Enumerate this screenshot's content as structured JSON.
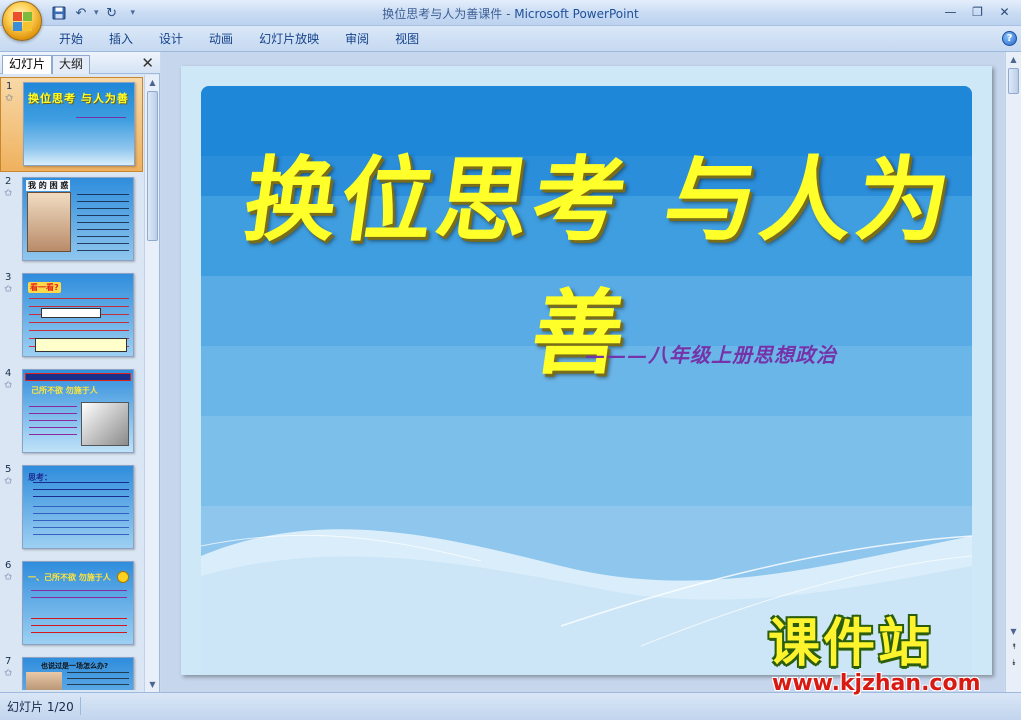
{
  "window": {
    "title": "换位思考与人为善课件",
    "app_name": "Microsoft PowerPoint",
    "title_separator": " - "
  },
  "quick_access": {
    "save_icon": "save-icon",
    "undo_icon": "undo-icon",
    "redo_icon": "redo-icon"
  },
  "ribbon": {
    "tabs": [
      {
        "label": "开始"
      },
      {
        "label": "插入"
      },
      {
        "label": "设计"
      },
      {
        "label": "动画"
      },
      {
        "label": "幻灯片放映"
      },
      {
        "label": "审阅"
      },
      {
        "label": "视图"
      }
    ],
    "help_label": "?"
  },
  "left_pane": {
    "tab_slides": "幻灯片",
    "tab_outline": "大纲",
    "close_label": "✕",
    "thumbnails": [
      {
        "number": "1",
        "selected": true
      },
      {
        "number": "2",
        "selected": false
      },
      {
        "number": "3",
        "selected": false
      },
      {
        "number": "4",
        "selected": false
      },
      {
        "number": "5",
        "selected": false
      },
      {
        "number": "6",
        "selected": false
      },
      {
        "number": "7",
        "selected": false
      }
    ],
    "thumb_text": {
      "s1_title": "换位思考  与人为善",
      "s2_title": "我 的 困 惑",
      "s3_title": "看一看?",
      "s4_title": "己所不欲  勿施于人",
      "s5_title": "思考：",
      "s6_title": "一、己所不欲   勿施于人",
      "s7_title": "也说过是一场怎么办?"
    }
  },
  "slide": {
    "title": "换位思考  与人为善",
    "subtitle": "———八年级上册思想政治",
    "colors": {
      "title": "#ffff2a",
      "subtitle": "#7433a8",
      "band_top": "#1f87d8",
      "band_bottom": "#8fc6ee"
    }
  },
  "status": {
    "slide_indicator": "幻灯片 1/20"
  },
  "watermark": {
    "chinese": "课件站",
    "url": "www.kjzhan.com"
  }
}
